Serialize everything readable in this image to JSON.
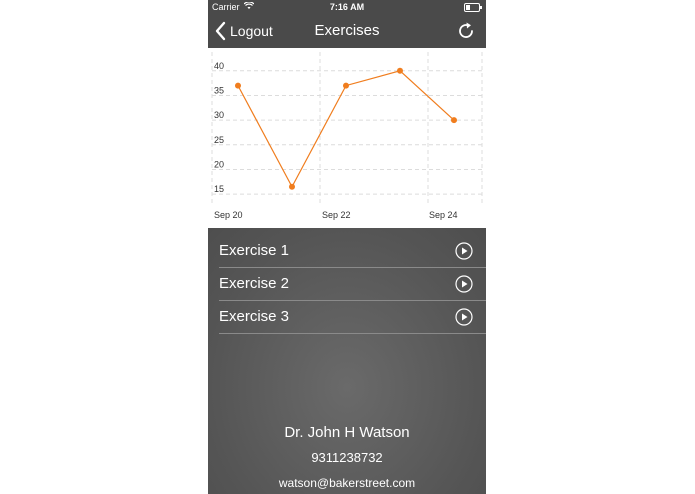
{
  "status_bar": {
    "carrier": "Carrier",
    "time": "7:16 AM",
    "wifi_icon": "wifi-icon",
    "battery_icon": "battery-icon"
  },
  "nav": {
    "back_label": "Logout",
    "back_icon": "chevron-left-icon",
    "title": "Exercises",
    "refresh_icon": "refresh-icon"
  },
  "colors": {
    "accent": "#f07d1e",
    "nav_background": "#4a4a4a",
    "list_background": "#5a5a5a",
    "text_light": "#ffffff"
  },
  "chart_data": {
    "type": "line",
    "x": [
      "Sep 20",
      "Sep 21",
      "Sep 22",
      "Sep 23",
      "Sep 24"
    ],
    "x_tick_labels": [
      "Sep 20",
      "Sep 22",
      "Sep 24"
    ],
    "values": [
      37,
      16.5,
      37,
      40,
      30
    ],
    "y_ticks": [
      15,
      20,
      25,
      30,
      35,
      40
    ],
    "ylim": [
      13,
      43
    ],
    "grid": true,
    "grid_style": "dashed",
    "color": "#f07d1e"
  },
  "exercises": [
    {
      "label": "Exercise 1",
      "icon": "play-icon"
    },
    {
      "label": "Exercise 2",
      "icon": "play-icon"
    },
    {
      "label": "Exercise 3",
      "icon": "play-icon"
    }
  ],
  "profile": {
    "name": "Dr. John H Watson",
    "phone": "9311238732",
    "email": "watson@bakerstreet.com"
  }
}
